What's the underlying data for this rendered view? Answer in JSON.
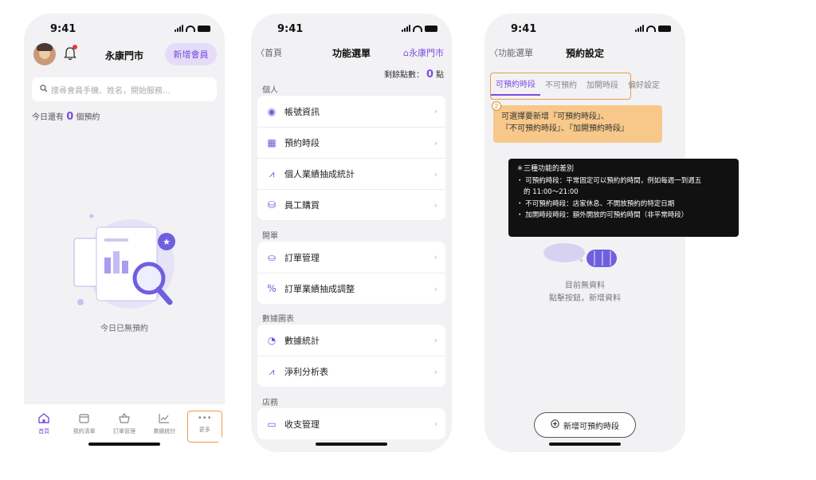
{
  "status": {
    "time": "9:41"
  },
  "screen1": {
    "store_name": "永康門市",
    "new_member_label": "新增會員",
    "search_placeholder": "搜尋會員手機、姓名，開始服務...",
    "today_prefix": "今日還有",
    "today_count": "0",
    "today_suffix": "個預約",
    "empty_text": "今日已無預約",
    "tabs": [
      {
        "label": "首頁",
        "icon": "home-icon"
      },
      {
        "label": "預約清單",
        "icon": "calendar-icon"
      },
      {
        "label": "訂單管理",
        "icon": "basket-icon"
      },
      {
        "label": "業績統計",
        "icon": "chart-icon"
      },
      {
        "label": "更多",
        "icon": "more-icon"
      }
    ]
  },
  "screen2": {
    "back_label": "首頁",
    "title": "功能選單",
    "store_label": "永康門市",
    "points_label": "剩餘點數：",
    "points_value": "0",
    "points_unit": "點",
    "sections": [
      {
        "title": "個人",
        "items": [
          "帳號資訊",
          "預約時段",
          "個人業績抽成統計",
          "員工購買"
        ]
      },
      {
        "title": "開單",
        "items": [
          "訂單管理",
          "訂單業績抽成調整"
        ]
      },
      {
        "title": "數據圖表",
        "items": [
          "數據統計",
          "淨利分析表"
        ]
      },
      {
        "title": "店務",
        "items": [
          "收支管理"
        ]
      }
    ]
  },
  "screen3": {
    "back_label": "功能選單",
    "title": "預約設定",
    "tabs": [
      "可預約時段",
      "不可預約",
      "加開時段",
      "偏好設定"
    ],
    "step_number": "2",
    "note_line1": "可選擇要新增『可預約時段』、",
    "note_line2": "『不可預約時段』、『加開預約時段』",
    "empty_line1": "目前無資料",
    "empty_line2": "點擊按鈕，新增資料",
    "add_button": "新增可預約時段"
  },
  "tooltip": {
    "title": "＊三種功能的差別",
    "line1": "・ 可預約時段：平常固定可以預約的時間，例如每週一到週五",
    "line2": "的 11:00～21:00",
    "line3": "・ 不可預約時段：店家休息、不開放預約的特定日期",
    "line4": "・ 加開時段時段：額外開放的可預約時間（非平常時段）"
  },
  "colors": {
    "accent": "#7c4ee0",
    "highlight": "#ee9a4a",
    "note_bg": "#f8c88a"
  }
}
